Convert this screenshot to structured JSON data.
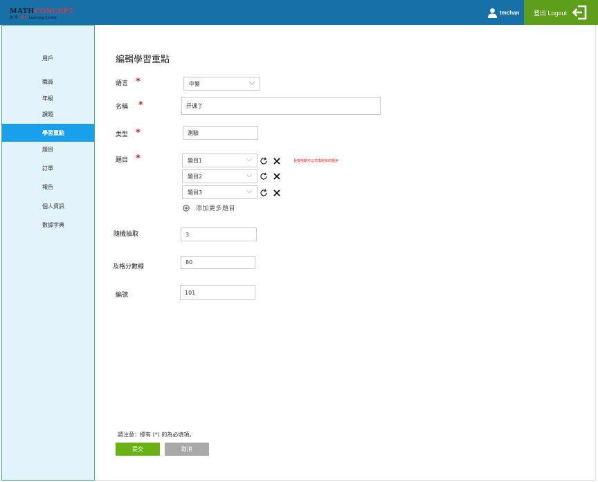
{
  "header": {
    "logo_main_a": "MATH",
    "logo_main_b": "CONCEPT",
    "logo_sub_a": "數 學 ·",
    "logo_sub_b": "概念",
    "logo_sub_c": "Learning Center",
    "username": "tmchan",
    "logout_label": "登出 Logout"
  },
  "sidebar": {
    "items": [
      {
        "label": "用戶"
      },
      {
        "label": "職員"
      },
      {
        "label": "年級"
      },
      {
        "label": "課題"
      },
      {
        "label": "學習重點"
      },
      {
        "label": "題目"
      },
      {
        "label": "訂單"
      },
      {
        "label": "報告"
      },
      {
        "label": "個人資訊"
      },
      {
        "label": "數據字典"
      }
    ],
    "active_index": 4
  },
  "form": {
    "title": "編輯學習重點",
    "required_mark": "*",
    "language": {
      "label": "語言",
      "value": "中繁"
    },
    "name": {
      "label": "名稱",
      "value": "开课了"
    },
    "type": {
      "label": "类型",
      "value": "測驗"
    },
    "questions": {
      "label": "題目",
      "items": [
        {
          "value": "題目1"
        },
        {
          "value": "題目2"
        },
        {
          "value": "題目3"
        }
      ],
      "hint": "長按拖動可以交換題目的順序",
      "add_more_label": "添加更多題目"
    },
    "random_pick": {
      "label": "隨機抽取",
      "value": "3"
    },
    "pass_score": {
      "label": "及格分數線",
      "value": "80"
    },
    "code": {
      "label": "編號",
      "value": "101"
    },
    "note": "請注意：標有 (*) 的為必填項。",
    "submit_label": "提交",
    "cancel_label": "取消"
  },
  "colors": {
    "header_bg": "#1770a8",
    "logout_bg": "#5d9e1a",
    "sidebar_bg": "#e3f3fc",
    "sidebar_active": "#1a9fea",
    "required": "#d52222",
    "submit_bg": "#6ab212",
    "cancel_bg": "#a8a8a8"
  }
}
